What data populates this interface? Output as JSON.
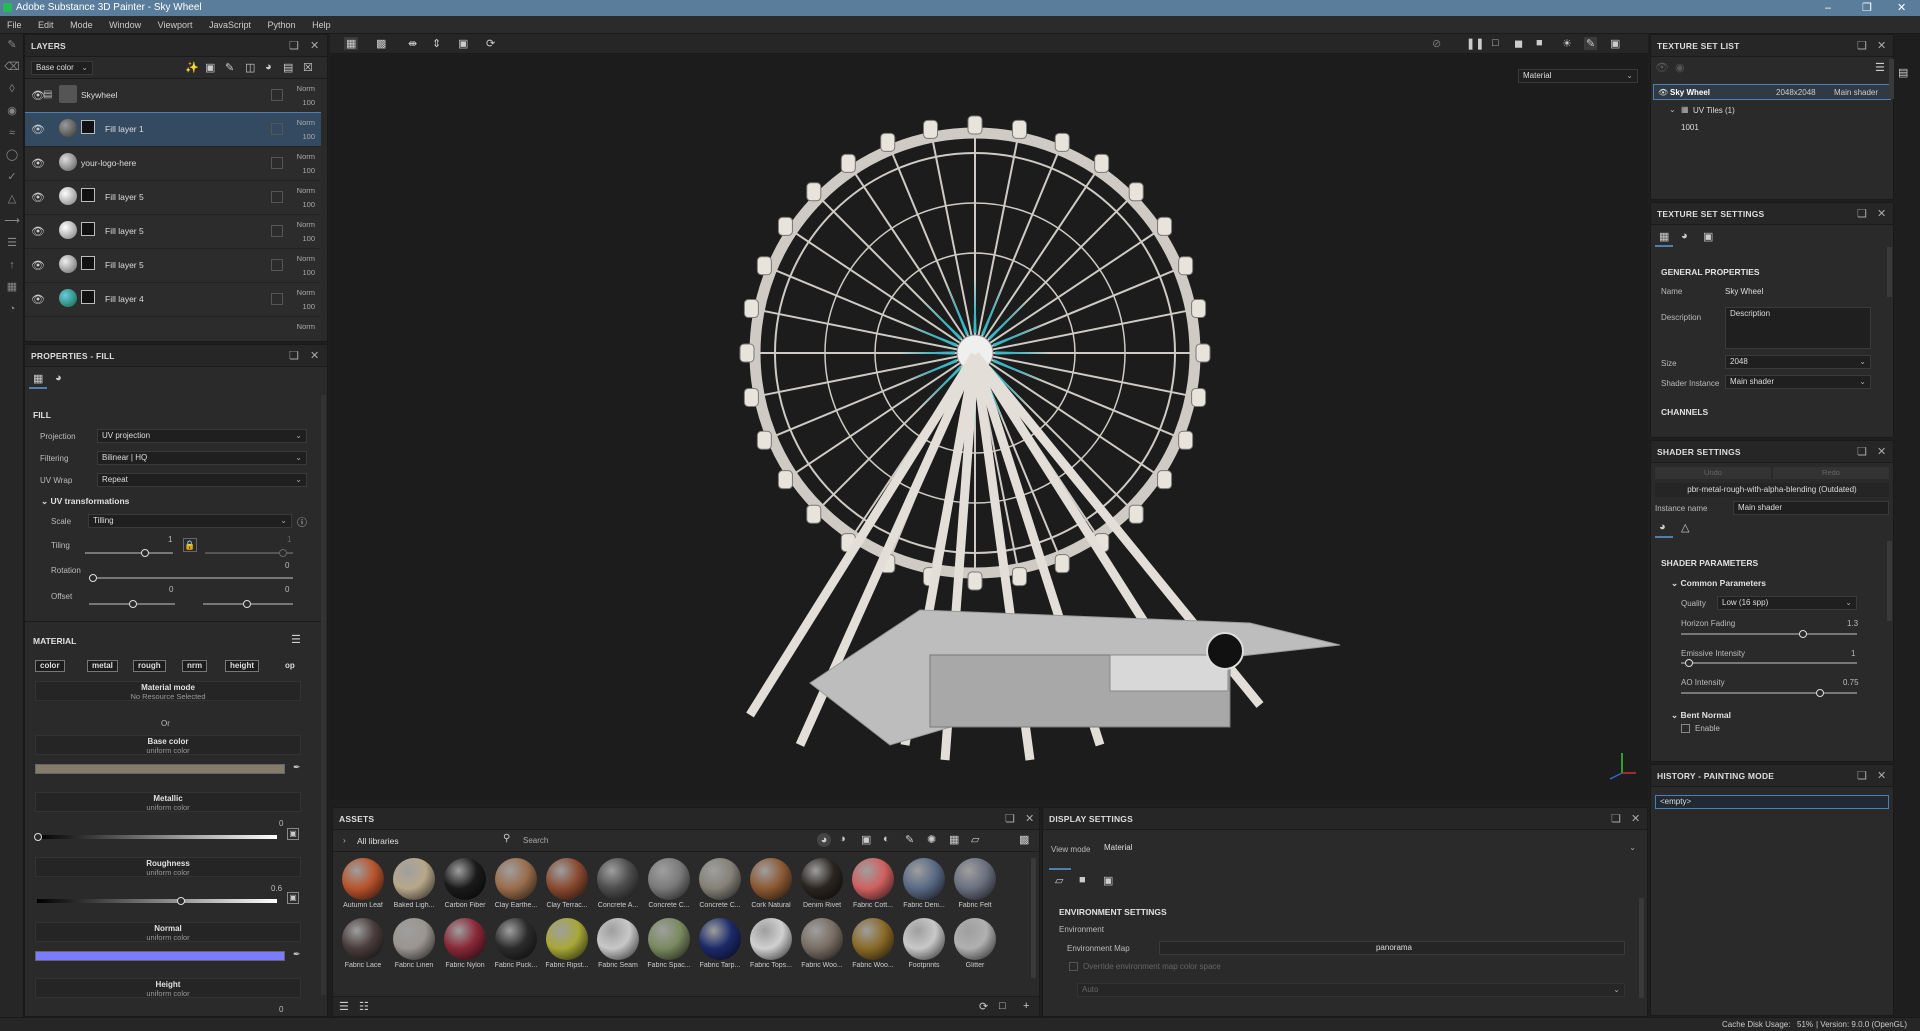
{
  "app": {
    "title": "Adobe Substance 3D Painter - Sky Wheel"
  },
  "menu": [
    "File",
    "Edit",
    "Mode",
    "Window",
    "Viewport",
    "JavaScript",
    "Python",
    "Help"
  ],
  "layers": {
    "title": "LAYERS",
    "channel": "Base color",
    "items": [
      {
        "name": "Skywheel",
        "blend": "Norm",
        "opacity": "100",
        "type": "folder",
        "color": "#777"
      },
      {
        "name": "Fill layer 1",
        "blend": "Norm",
        "opacity": "100",
        "type": "fill",
        "color": "#5a5a5a"
      },
      {
        "name": "your-logo-here",
        "blend": "Norm",
        "opacity": "100",
        "type": "paint",
        "color": "#999"
      },
      {
        "name": "Fill layer 5",
        "blend": "Norm",
        "opacity": "100",
        "type": "fill",
        "color": "#cfcfcf"
      },
      {
        "name": "Fill layer 5",
        "blend": "Norm",
        "opacity": "100",
        "type": "fill",
        "color": "#cfcfcf"
      },
      {
        "name": "Fill layer 5",
        "blend": "Norm",
        "opacity": "100",
        "type": "fill",
        "color": "#bfbfbf"
      },
      {
        "name": "Fill layer 4",
        "blend": "Norm",
        "opacity": "100",
        "type": "fill",
        "color": "#2a8a96"
      }
    ],
    "partial": "Norm"
  },
  "properties": {
    "title": "PROPERTIES - FILL",
    "fill_header": "FILL",
    "projection_label": "Projection",
    "projection": "UV projection",
    "filtering_label": "Filtering",
    "filtering": "Bilinear | HQ",
    "uvwrap_label": "UV Wrap",
    "uvwrap": "Repeat",
    "uvtrans": "UV transformations",
    "scale_label": "Scale",
    "scale": "Tilling",
    "tiling_label": "Tiling",
    "tiling_val": "1",
    "tiling_val2": "1",
    "rotation_label": "Rotation",
    "rotation_val": "0",
    "offset_label": "Offset",
    "offset_val1": "0",
    "offset_val2": "0",
    "material_header": "MATERIAL",
    "chips": [
      "color",
      "metal",
      "rough",
      "nrm",
      "height",
      "op"
    ],
    "material_mode": "Material mode",
    "no_resource": "No Resource Selected",
    "or": "Or",
    "base_color": "Base color",
    "uniform": "uniform color",
    "metallic": "Metallic",
    "metallic_val": "0",
    "roughness": "Roughness",
    "roughness_val": "0.6",
    "normal": "Normal",
    "height": "Height",
    "height_val": "0",
    "base_color_hex": "#857b6b",
    "normal_hex": "#7b7bff"
  },
  "viewport": {
    "mode": "Material"
  },
  "assets": {
    "title": "ASSETS",
    "library": "All libraries",
    "search_placeholder": "Search",
    "row1": [
      {
        "name": "Autumn Leaf",
        "c": "#b8542c"
      },
      {
        "name": "Baked Ligh...",
        "c": "#b8a88a"
      },
      {
        "name": "Carbon Fiber",
        "c": "#1a1a1a"
      },
      {
        "name": "Clay Earthe...",
        "c": "#9a6d4c"
      },
      {
        "name": "Clay Terrac...",
        "c": "#8a4a30"
      },
      {
        "name": "Concrete A...",
        "c": "#4d4d4d"
      },
      {
        "name": "Concrete C...",
        "c": "#7a7a7a"
      },
      {
        "name": "Concrete C...",
        "c": "#858178"
      },
      {
        "name": "Cork Natural",
        "c": "#8c5a34"
      },
      {
        "name": "Denim Rivet",
        "c": "#2a2520"
      },
      {
        "name": "Fabric Cott...",
        "c": "#d06060"
      },
      {
        "name": "Fabric Deni...",
        "c": "#5a6a85"
      },
      {
        "name": "Fabric Felt",
        "c": "#6a7080"
      }
    ],
    "row2": [
      {
        "name": "Fabric Lace",
        "c": "#4a3c3c"
      },
      {
        "name": "Fabric Linen",
        "c": "#9a9590"
      },
      {
        "name": "Fabric Nylon",
        "c": "#8a2838"
      },
      {
        "name": "Fabric Puck...",
        "c": "#2b2b2b"
      },
      {
        "name": "Fabric Ripst...",
        "c": "#a8a838"
      },
      {
        "name": "Fabric Seam",
        "c": "#c8c8c8"
      },
      {
        "name": "Fabric Spac...",
        "c": "#7a8a60"
      },
      {
        "name": "Fabric Tarp...",
        "c": "#1c2a6a"
      },
      {
        "name": "Fabric Tops...",
        "c": "#d0d0d0"
      },
      {
        "name": "Fabric Woo...",
        "c": "#7a6e64"
      },
      {
        "name": "Fabric Woo...",
        "c": "#8a6a28"
      },
      {
        "name": "Footprints",
        "c": "#c8c8c8"
      },
      {
        "name": "Glitter",
        "c": "#b0b0b0"
      }
    ]
  },
  "display": {
    "title": "DISPLAY SETTINGS",
    "view_mode_label": "View mode",
    "view_mode": "Material",
    "env_settings": "ENVIRONMENT SETTINGS",
    "environment": "Environment",
    "env_map_label": "Environment Map",
    "env_map": "panorama",
    "override": "Override environment map color space",
    "auto": "Auto"
  },
  "texture_set_list": {
    "title": "TEXTURE SET LIST",
    "name": "Sky Wheel",
    "size": "2048x2048",
    "shader": "Main shader",
    "uv_tiles": "UV Tiles (1)",
    "tile": "1001"
  },
  "texture_set_settings": {
    "title": "TEXTURE SET SETTINGS",
    "general": "GENERAL PROPERTIES",
    "name_label": "Name",
    "name": "Sky Wheel",
    "desc_label": "Description",
    "desc": "Description",
    "size_label": "Size",
    "size": "2048",
    "shader_inst_label": "Shader Instance",
    "shader_inst": "Main shader",
    "channels": "CHANNELS"
  },
  "shader_settings": {
    "title": "SHADER SETTINGS",
    "undo": "Undo",
    "redo": "Redo",
    "shader": "pbr-metal-rough-with-alpha-blending (Outdated)",
    "instance_label": "Instance name",
    "instance": "Main shader",
    "params": "SHADER PARAMETERS",
    "common": "Common Parameters",
    "quality_label": "Quality",
    "quality": "Low (16 spp)",
    "horizon_label": "Horizon Fading",
    "horizon": "1.3",
    "emissive_label": "Emissive Intensity",
    "emissive": "1",
    "ao_label": "AO Intensity",
    "ao": "0.75",
    "bent": "Bent Normal",
    "enable": "Enable"
  },
  "history": {
    "title": "HISTORY - PAINTING MODE",
    "empty": "<empty>"
  },
  "status": {
    "cache": "Cache Disk Usage:",
    "cache_val": "51%",
    "version": "| Version: 9.0.0 (OpenGL)"
  },
  "colors": {
    "accent": "#4f7fb1",
    "teal": "#3ab7c5"
  }
}
